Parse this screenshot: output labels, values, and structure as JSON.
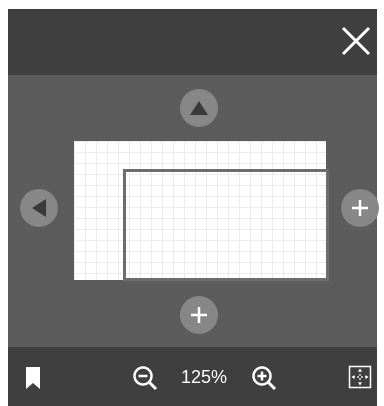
{
  "window": {
    "close_icon": "close-icon"
  },
  "navigation": {
    "up_icon": "triangle-up-icon",
    "left_icon": "triangle-left-icon",
    "right_icon": "plus-icon",
    "down_icon": "plus-icon"
  },
  "toolbar": {
    "bookmark_icon": "bookmark-icon",
    "zoom_out_icon": "zoom-out-icon",
    "zoom_level": "125%",
    "zoom_in_icon": "zoom-in-icon",
    "fit_icon": "fit-to-screen-icon"
  },
  "colors": {
    "panel": "#5c5c5c",
    "bars": "#3f3f3f",
    "button": "#878787",
    "view_frame": "#6d6d6d"
  }
}
